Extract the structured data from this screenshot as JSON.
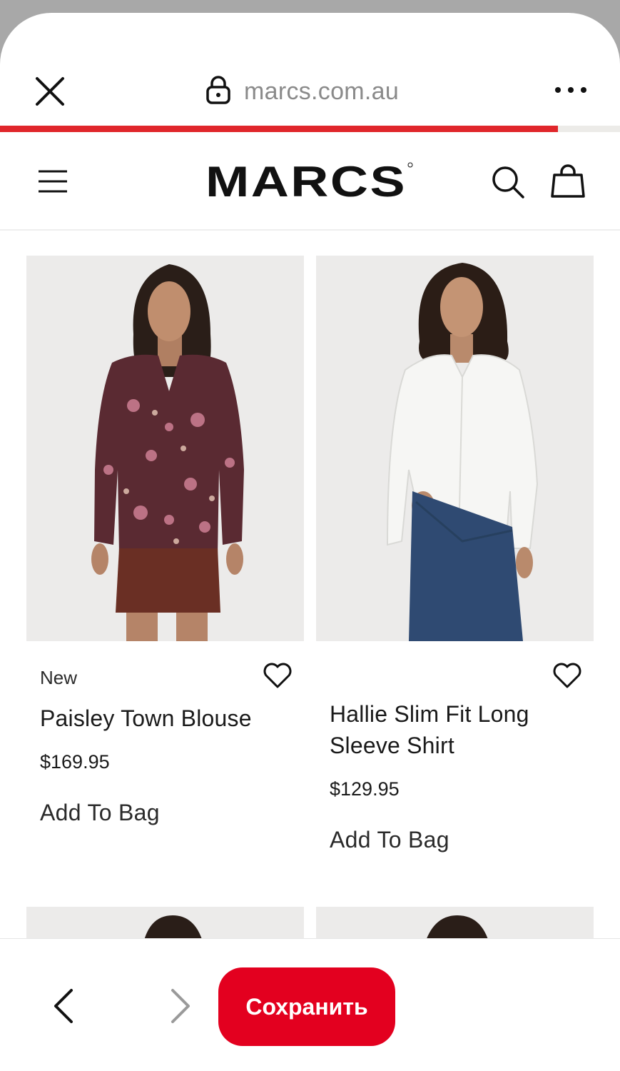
{
  "browser": {
    "url": "marcs.com.au",
    "load_progress": 0.9,
    "icons": {
      "close": "close-icon",
      "lock": "lock-icon",
      "more": "more-horizontal-icon"
    }
  },
  "header": {
    "brand": "MARCS",
    "icons": {
      "menu": "hamburger-icon",
      "search": "search-icon",
      "bag": "shopping-bag-icon"
    }
  },
  "products": [
    {
      "badge": "New",
      "name": "Paisley Town Blouse",
      "price": "$169.95",
      "cta": "Add To Bag"
    },
    {
      "badge": "",
      "name": "Hallie Slim Fit Long Sleeve Shirt",
      "price": "$129.95",
      "cta": "Add To Bag"
    }
  ],
  "bottom_bar": {
    "save_label": "Сохранить",
    "icons": {
      "back": "chevron-left-icon",
      "forward": "chevron-right-icon"
    }
  },
  "colors": {
    "accent_red": "#e3001f",
    "progress_red": "#e0262b",
    "text_dark": "#1a1a1a"
  }
}
